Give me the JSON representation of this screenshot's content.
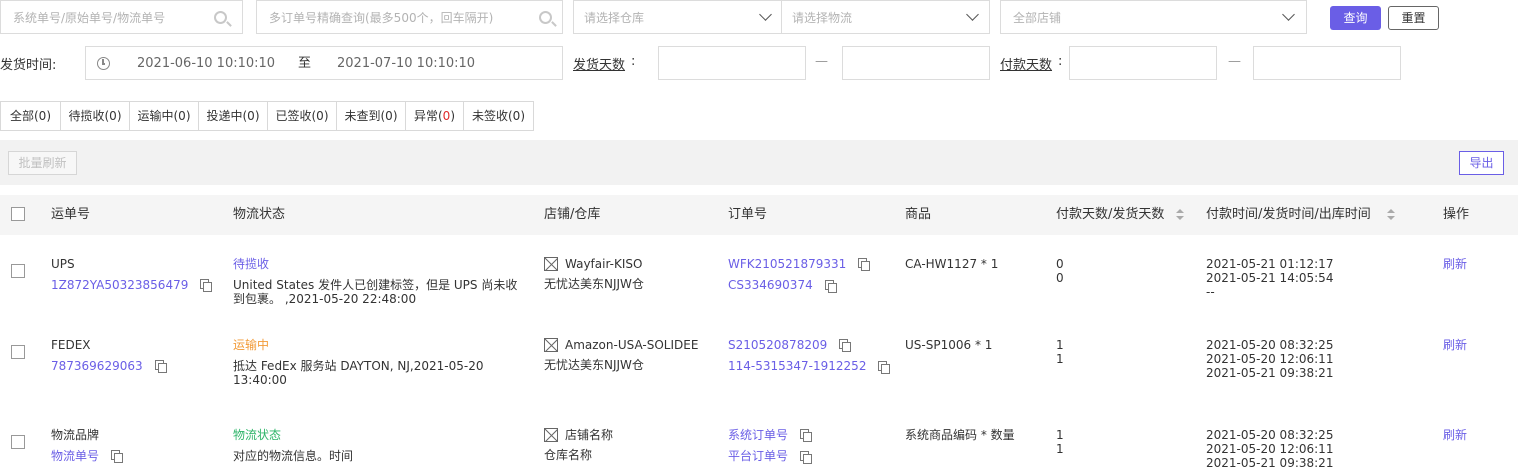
{
  "filters": {
    "order_no_placeholder": "系统单号/原始单号/物流单号",
    "multi_order_placeholder": "多订单号精确查询(最多500个，回车隔开)",
    "warehouse_placeholder": "请选择仓库",
    "logistics_placeholder": "请选择物流",
    "store_placeholder": "全部店铺",
    "query_label": "查询",
    "reset_label": "重置",
    "ship_time_label": "发货时间:",
    "ship_time_start": "2021-06-10  10:10:10",
    "ship_time_to": "至",
    "ship_time_end": "2021-07-10  10:10:10",
    "ship_days_label": "发货天数",
    "pay_days_label": "付款天数",
    "colon": ":",
    "dash": "—"
  },
  "tabs": [
    {
      "label": "全部(0)"
    },
    {
      "label": "待揽收(0)"
    },
    {
      "label": "运输中(0)"
    },
    {
      "label": "投递中(0)"
    },
    {
      "label": "已签收(0)"
    },
    {
      "label": "未查到(0)"
    },
    {
      "label_prefix": "异常(",
      "count": "0",
      "label_suffix": ")"
    },
    {
      "label": "未签收(0)"
    }
  ],
  "toolbar": {
    "batch_refresh": "批量刷新",
    "export": "导出"
  },
  "table": {
    "headers": [
      "运单号",
      "物流状态",
      "店铺/仓库",
      "订单号",
      "商品",
      "付款天数/发货天数",
      "付款时间/发货时间/出库时间",
      "操作"
    ],
    "rows": [
      {
        "carrier": "UPS",
        "tracking": "1Z872YA50323856479",
        "status": "待揽收",
        "status_color": "#6a5ee6",
        "detail": "United States 发件人已创建标签，但是 UPS 尚未收到包裹。 ,2021-05-20 22:48:00",
        "store": "Wayfair-KISO",
        "warehouse": "无忧达美东NJJW仓",
        "order1": "WFK210521879331",
        "order2": "CS334690374",
        "product": "CA-HW1127 * 1",
        "pay_days": "0",
        "ship_days": "0",
        "time1": "2021-05-21 01:12:17",
        "time2": "2021-05-21 14:05:54",
        "time3": "--",
        "action": "刷新"
      },
      {
        "carrier": "FEDEX",
        "tracking": "787369629063",
        "status": "运输中",
        "status_color": "#f29b38",
        "detail": "抵达 FedEx 服务站 DAYTON, NJ,2021-05-20 13:40:00",
        "store": "Amazon-USA-SOLIDEE",
        "warehouse": "无忧达美东NJJW仓",
        "order1": "S210520878209",
        "order2": "114-5315347-1912252",
        "product": "US-SP1006 * 1",
        "pay_days": "1",
        "ship_days": "1",
        "time1": "2021-05-20 08:32:25",
        "time2": "2021-05-20 12:06:11",
        "time3": "2021-05-21 09:38:21",
        "action": "刷新"
      },
      {
        "carrier": "物流品牌",
        "tracking": "物流单号",
        "status": "物流状态",
        "status_color": "#2fb56a",
        "detail": "对应的物流信息。时间",
        "store": "店铺名称",
        "warehouse": "仓库名称",
        "order1": "系统订单号",
        "order2": "平台订单号",
        "product": "系统商品编码 * 数量",
        "pay_days": "1",
        "ship_days": "1",
        "time1": "2021-05-20 08:32:25",
        "time2": "2021-05-20 12:06:11",
        "time3": "2021-05-21 09:38:21",
        "action": "刷新"
      }
    ]
  },
  "colors": {
    "accent": "#6a5ee6",
    "danger": "#e02b2b"
  }
}
